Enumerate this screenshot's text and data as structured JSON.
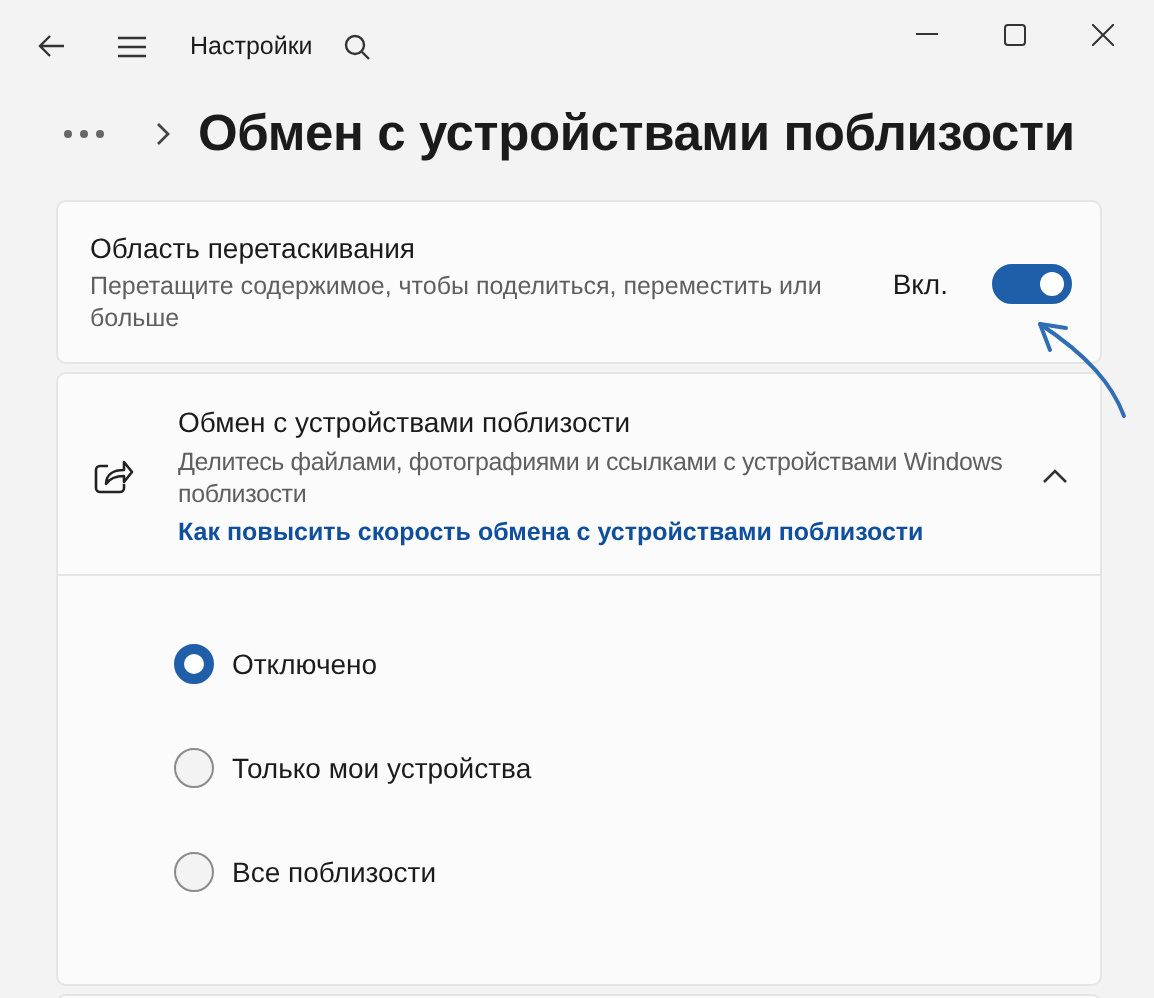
{
  "window": {
    "title": "Настройки"
  },
  "header": {
    "title": "Обмен с устройствами поблизости"
  },
  "drag_area": {
    "title": "Область перетаскивания",
    "description": "Перетащите содержимое, чтобы поделиться, переместить или больше",
    "state_label": "Вкл.",
    "on": true
  },
  "nearby_sharing": {
    "title": "Обмен с устройствами поблизости",
    "description": "Делитесь файлами, фотографиями и ссылками с устройствами Windows поблизости",
    "link": "Как повысить скорость обмена с устройствами поблизости",
    "expanded": true,
    "options": [
      {
        "label": "Отключено",
        "selected": true
      },
      {
        "label": "Только мои устройства",
        "selected": false
      },
      {
        "label": "Все поблизости",
        "selected": false
      }
    ]
  }
}
